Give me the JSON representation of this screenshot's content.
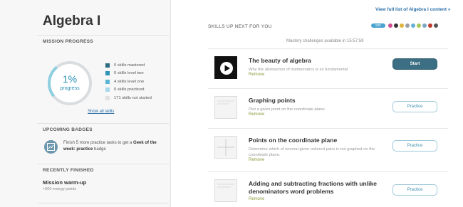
{
  "sidebar": {
    "title": "Algebra I",
    "mission_progress_heading": "MISSION PROGRESS",
    "progress": {
      "percent_text": "1%",
      "label": "progress",
      "fraction": 0.01
    },
    "legend": [
      {
        "text": "0 skills mastered",
        "color": "#2d6b80"
      },
      {
        "text": "0 skills level two",
        "color": "#2f95b8"
      },
      {
        "text": "4 skills level one",
        "color": "#5ab6d6"
      },
      {
        "text": "0 skills practiced",
        "color": "#a7d9ea"
      },
      {
        "text": "171 skills not started",
        "color": "#e1e1e1"
      }
    ],
    "show_all": "Show all skills",
    "upcoming_heading": "UPCOMING BADGES",
    "badge": {
      "prefix": "Finish 5 more practice tasks to get a ",
      "bold": "Geek of the week: practice",
      "suffix": " badge",
      "icon": "chart-icon"
    },
    "recent_heading": "RECENTLY FINISHED",
    "recent": {
      "title": "Mission warm-up",
      "sub": "+500 energy points"
    }
  },
  "main": {
    "view_full": "View full list of Algebra I content »",
    "heading": "SKILLS UP NEXT FOR YOU",
    "pill_label": "500",
    "dot_colors": [
      "#d14b8f",
      "#333333",
      "#e0b53a",
      "#9aa0a6",
      "#63b0d8",
      "#a7c957",
      "#7fa7c4",
      "#c0392b",
      "#555555"
    ],
    "mastery_note": "Mastery challenges available in 15:57:59",
    "cards": [
      {
        "title": "The beauty of algebra",
        "desc": "Why the abstraction of mathematics is so fundamental",
        "remove": "Remove",
        "button": "Start",
        "thumb": "video"
      },
      {
        "title": "Graphing points",
        "desc": "Plot a given point on the coordinate plane.",
        "remove": "Remove",
        "button": "Practice",
        "thumb": "exercise"
      },
      {
        "title": "Points on the coordinate plane",
        "desc": "Determine which of several given ordered pairs is not graphed on the coordinate plane.",
        "remove": "Remove",
        "button": "Practice",
        "thumb": "exercise"
      },
      {
        "title": "Adding and subtracting fractions with unlike denominators word problems",
        "desc": "",
        "remove": "Remove",
        "button": "Practice",
        "thumb": "exercise"
      }
    ]
  }
}
